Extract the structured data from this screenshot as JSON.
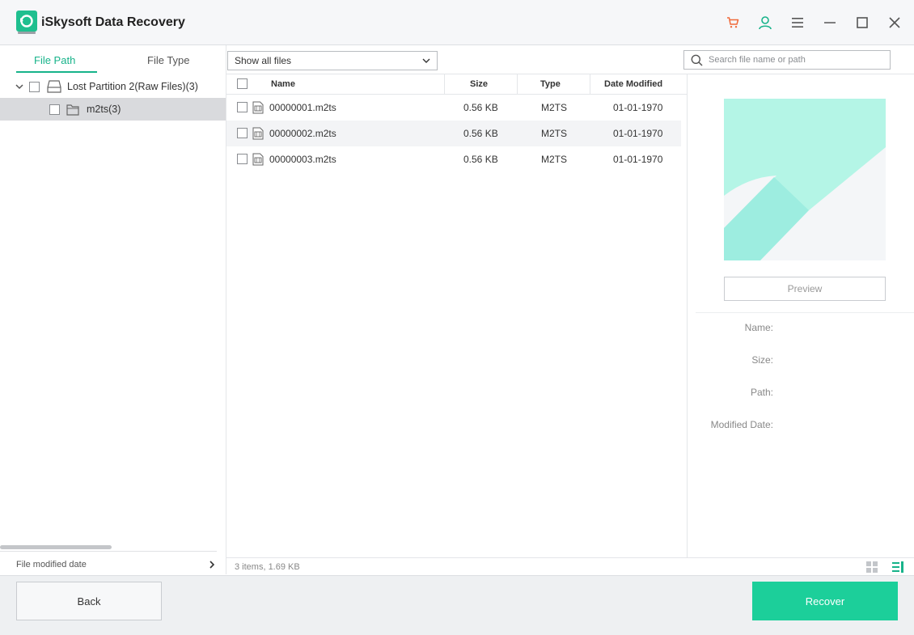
{
  "app": {
    "title": "iSkysoft Data Recovery"
  },
  "titlebar": {
    "icons": [
      "cart-icon",
      "user-icon",
      "menu-icon",
      "minimize-icon",
      "maximize-icon",
      "close-icon"
    ]
  },
  "left": {
    "tabs": [
      {
        "label": "File Path",
        "active": true
      },
      {
        "label": "File Type",
        "active": false
      }
    ],
    "tree": [
      {
        "label": "Lost Partition 2(Raw Files)(3)",
        "icon": "drive-icon",
        "expanded": true
      },
      {
        "label": "m2ts(3)",
        "icon": "folder-icon",
        "selected": true
      }
    ],
    "filter_label": "File modified date"
  },
  "toolbar": {
    "filter_select": "Show all files",
    "search_placeholder": "Search file name or path"
  },
  "table": {
    "columns": [
      "Name",
      "Size",
      "Type",
      "Date Modified"
    ],
    "rows": [
      {
        "name": "00000001.m2ts",
        "size": "0.56  KB",
        "type": "M2TS",
        "date": "01-01-1970"
      },
      {
        "name": "00000002.m2ts",
        "size": "0.56  KB",
        "type": "M2TS",
        "date": "01-01-1970"
      },
      {
        "name": "00000003.m2ts",
        "size": "0.56  KB",
        "type": "M2TS",
        "date": "01-01-1970"
      }
    ]
  },
  "preview": {
    "button_label": "Preview",
    "labels": {
      "name": "Name:",
      "size": "Size:",
      "path": "Path:",
      "modified": "Modified Date:"
    }
  },
  "status": {
    "text": "3 items, 1.69  KB"
  },
  "footer": {
    "back_label": "Back",
    "recover_label": "Recover"
  },
  "colors": {
    "accent": "#17b38a",
    "recover": "#1ccf9a",
    "cart": "#f06a3a",
    "thumb_light": "#b4f5e6",
    "thumb_mid": "#9dede0"
  }
}
